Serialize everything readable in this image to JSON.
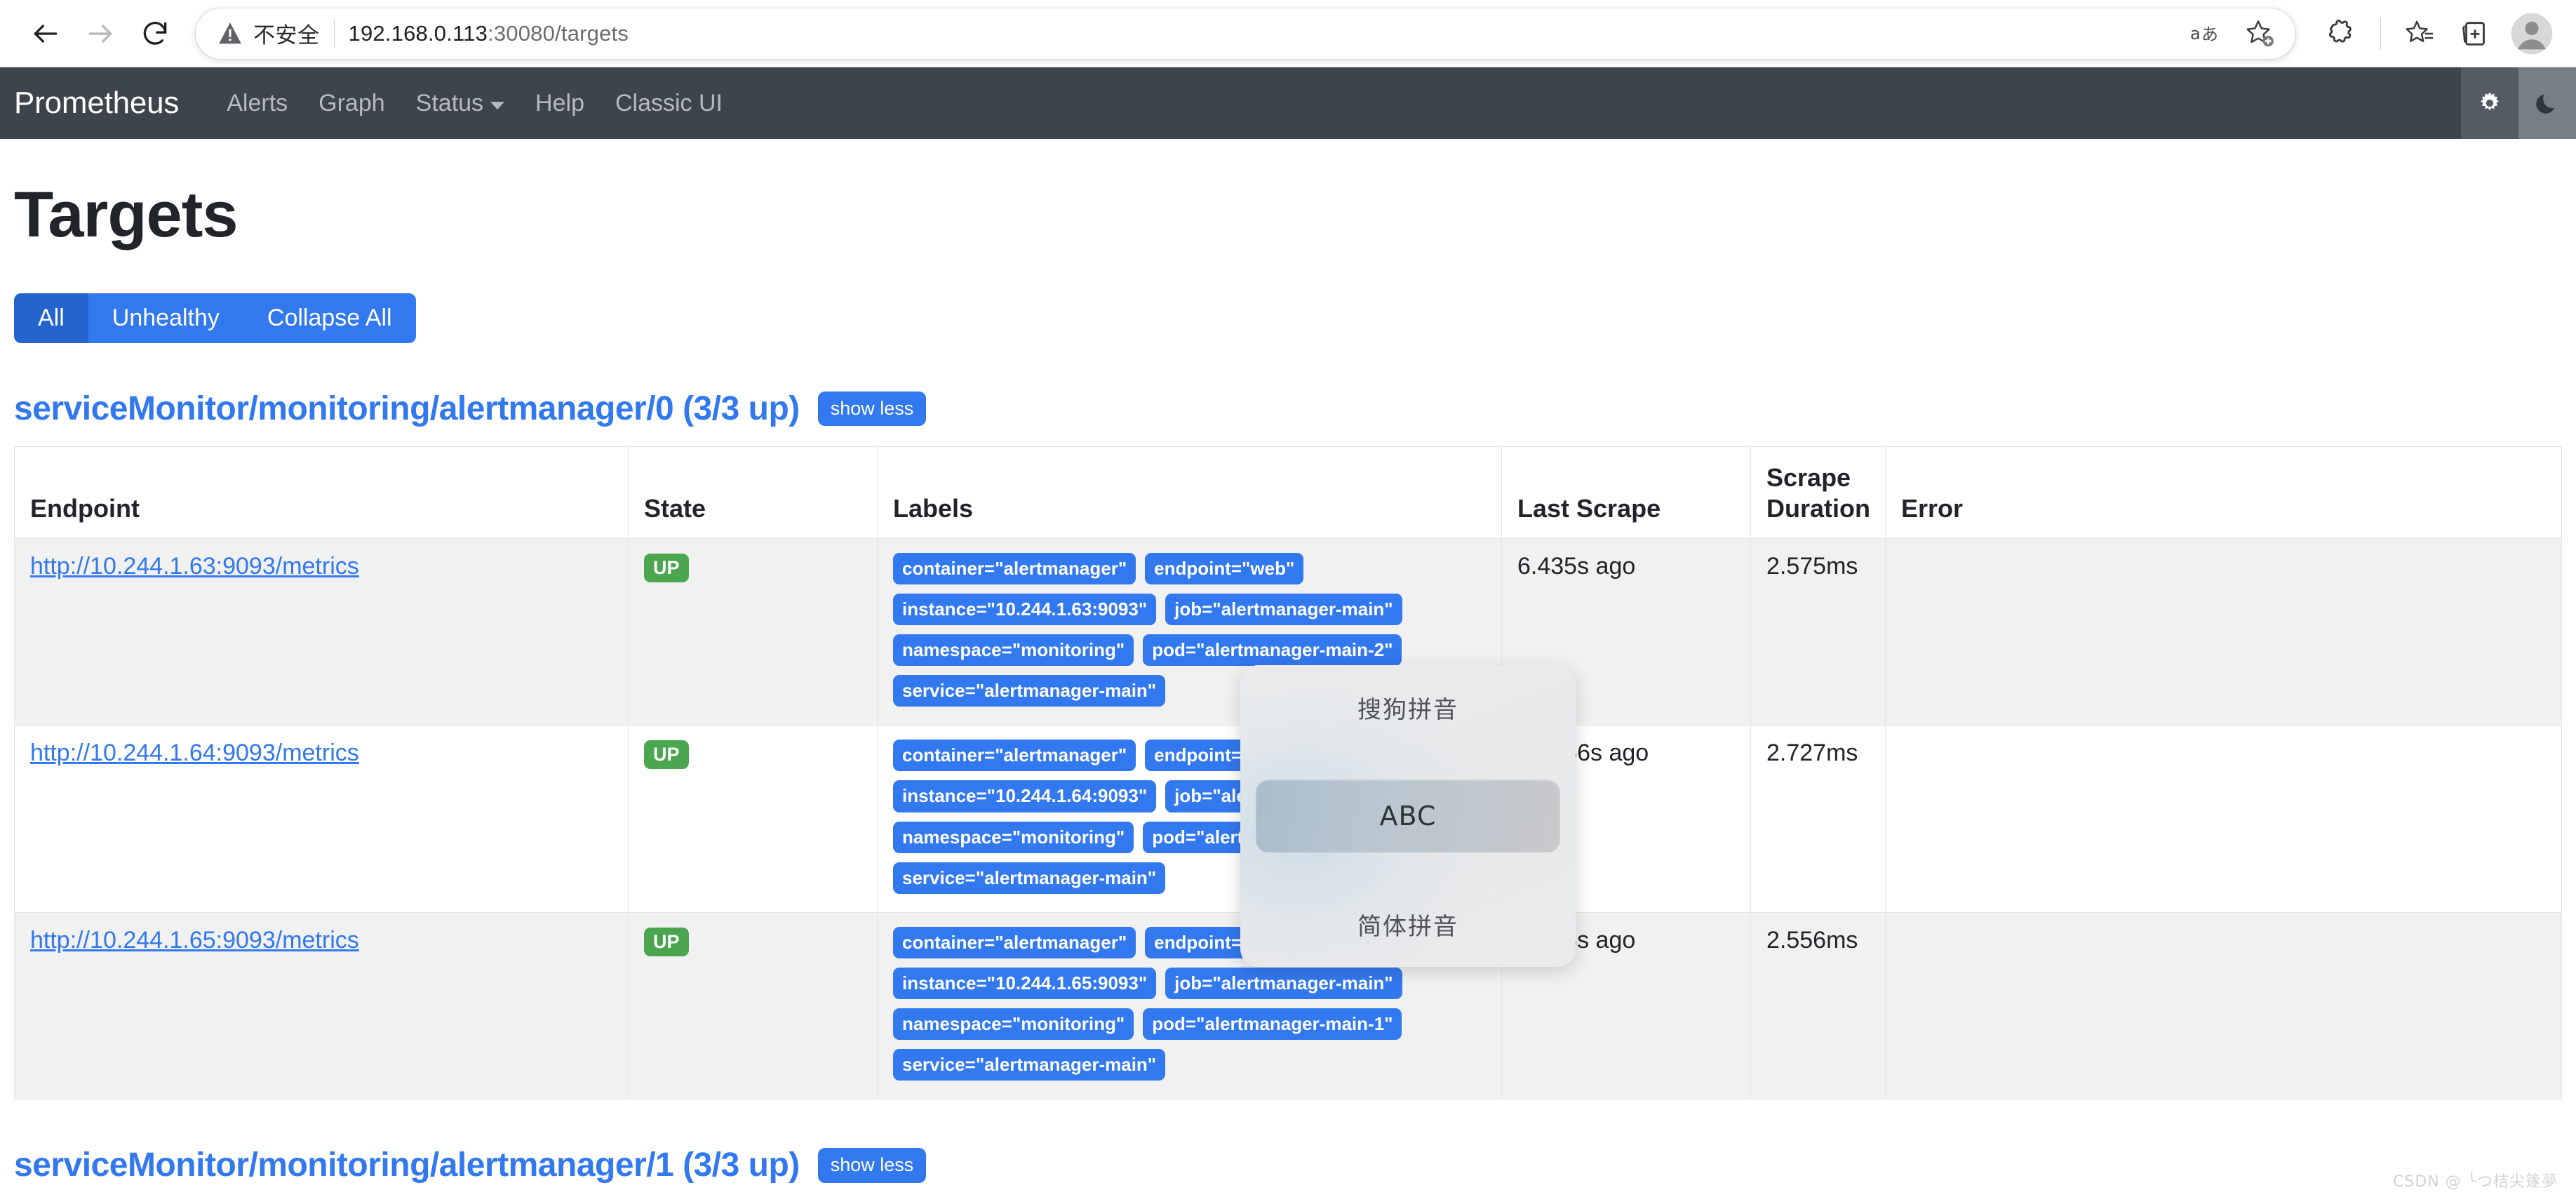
{
  "browser": {
    "back_label": "back-arrow",
    "forward_label": "forward-arrow",
    "reload_label": "reload",
    "security_text": "不安全",
    "url_host": "192.168.0.113",
    "url_rest": ":30080/targets",
    "url_full": "192.168.0.113:30080/targets",
    "right_icons": [
      {
        "name": "read-aloud-icon",
        "glyph": "aあ"
      },
      {
        "name": "add-favorite-icon",
        "glyph": "☆+"
      },
      {
        "name": "extensions-icon",
        "glyph": "puzzle"
      },
      {
        "name": "favorites-icon",
        "glyph": "☆≡"
      },
      {
        "name": "collections-icon",
        "glyph": "⊞"
      },
      {
        "name": "profile-avatar",
        "glyph": "person"
      }
    ]
  },
  "navbar": {
    "brand": "Prometheus",
    "links": [
      {
        "label": "Alerts",
        "has_caret": false
      },
      {
        "label": "Graph",
        "has_caret": false
      },
      {
        "label": "Status",
        "has_caret": true
      },
      {
        "label": "Help",
        "has_caret": false
      },
      {
        "label": "Classic UI",
        "has_caret": false
      }
    ],
    "light_theme_icon": "sun-gear-icon",
    "dark_theme_icon": "moon-icon"
  },
  "page": {
    "title": "Targets",
    "filters": [
      {
        "label": "All",
        "active": true
      },
      {
        "label": "Unhealthy",
        "active": false
      },
      {
        "label": "Collapse All",
        "active": false
      }
    ]
  },
  "groups": [
    {
      "title": "serviceMonitor/monitoring/alertmanager/0 (3/3 up)",
      "toggle_label": "show less",
      "columns": [
        "Endpoint",
        "State",
        "Labels",
        "Last Scrape",
        "Scrape Duration",
        "Error"
      ],
      "rows": [
        {
          "endpoint": "http://10.244.1.63:9093/metrics",
          "state": "UP",
          "labels": [
            "container=\"alertmanager\"",
            "endpoint=\"web\"",
            "instance=\"10.244.1.63:9093\"",
            "job=\"alertmanager-main\"",
            "namespace=\"monitoring\"",
            "pod=\"alertmanager-main-2\"",
            "service=\"alertmanager-main\""
          ],
          "last_scrape": "6.435s ago",
          "scrape_duration": "2.575ms",
          "error": ""
        },
        {
          "endpoint": "http://10.244.1.64:9093/metrics",
          "state": "UP",
          "labels": [
            "container=\"alertmanager\"",
            "endpoint=\"web\"",
            "instance=\"10.244.1.64:9093\"",
            "job=\"alertmanager-main\"",
            "namespace=\"monitoring\"",
            "pod=\"alertmanager-main-0\"",
            "service=\"alertmanager-main\""
          ],
          "last_scrape": "21.356s ago",
          "scrape_duration": "2.727ms",
          "error": ""
        },
        {
          "endpoint": "http://10.244.1.65:9093/metrics",
          "state": "UP",
          "labels": [
            "container=\"alertmanager\"",
            "endpoint=\"web\"",
            "instance=\"10.244.1.65:9093\"",
            "job=\"alertmanager-main\"",
            "namespace=\"monitoring\"",
            "pod=\"alertmanager-main-1\"",
            "service=\"alertmanager-main\""
          ],
          "last_scrape": "6.428s ago",
          "scrape_duration": "2.556ms",
          "error": ""
        }
      ]
    }
  ],
  "next_group": {
    "title": "serviceMonitor/monitoring/alertmanager/1 (3/3 up)",
    "toggle_label": "show less"
  },
  "ime_popup": {
    "items": [
      {
        "label": "搜狗拼音",
        "selected": false
      },
      {
        "label": "ABC",
        "selected": true
      },
      {
        "label": "简体拼音",
        "selected": false
      }
    ]
  },
  "watermark": "CSDN @ ╰つ桔尖篴夢",
  "colors": {
    "brand_blue": "#3278ee",
    "active_blue": "#2364cd",
    "up_green": "#4ba64f",
    "navbar_bg": "#3e444c"
  }
}
